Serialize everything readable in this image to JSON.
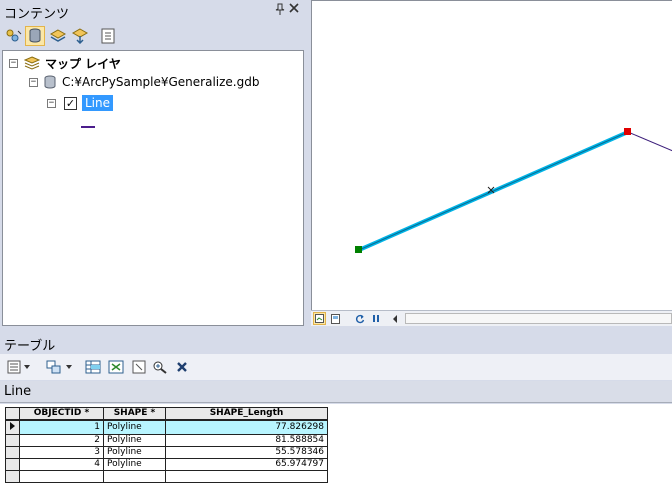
{
  "contents": {
    "title": "コンテンツ",
    "pin_glyph": "ᵽ",
    "close_glyph": "✕",
    "tree": {
      "root_label": "マップ レイヤ",
      "database_label": "C:¥ArcPySample¥Generalize.gdb",
      "layer_label": "Line",
      "layer_checked": true,
      "legend_color": "#4b1d8c"
    }
  },
  "map": {
    "line_color": "#00b4e6",
    "start_vertex_color": "#008000",
    "end_vertex_color": "#e00000",
    "continuation_color": "#3b1d7a"
  },
  "table_pane": {
    "title": "テーブル",
    "tab_label": "Line",
    "columns": [
      "OBJECTID *",
      "SHAPE *",
      "SHAPE_Length"
    ],
    "rows": [
      {
        "oid": "1",
        "shape": "Polyline",
        "length": "77.826298"
      },
      {
        "oid": "2",
        "shape": "Polyline",
        "length": "81.588854"
      },
      {
        "oid": "3",
        "shape": "Polyline",
        "length": "55.578346"
      },
      {
        "oid": "4",
        "shape": "Polyline",
        "length": "65.974797"
      }
    ],
    "highlight_color": "#b8f5ff"
  }
}
